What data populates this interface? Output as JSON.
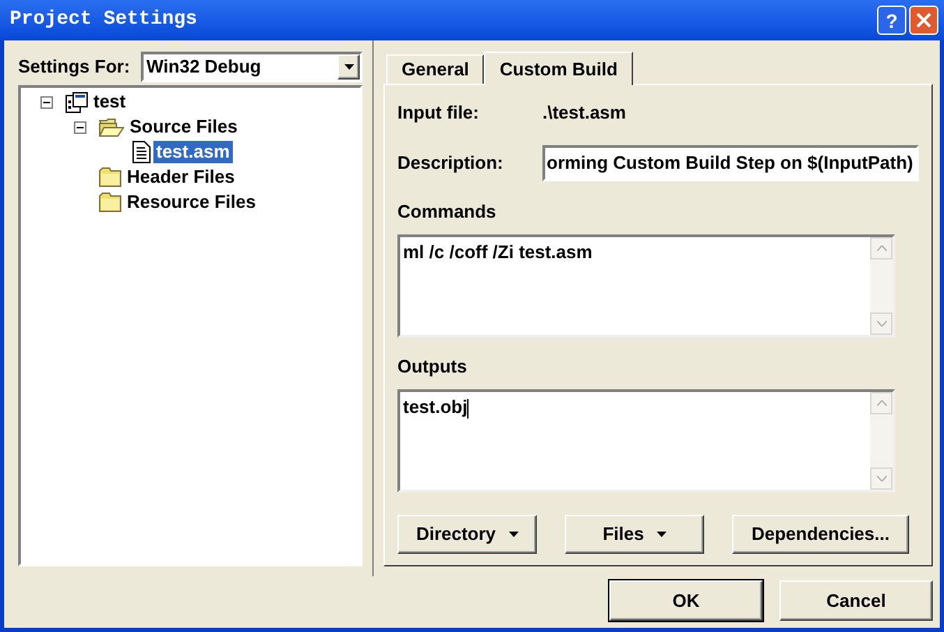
{
  "window": {
    "title": "Project Settings",
    "help_label": "?"
  },
  "settings_for": {
    "label": "Settings For:",
    "value": "Win32 Debug"
  },
  "tree": [
    {
      "label": "test",
      "kind": "project",
      "expanded": true,
      "selected": false,
      "children": [
        {
          "label": "Source Files",
          "kind": "folder",
          "expanded": true,
          "selected": false,
          "children": [
            {
              "label": "test.asm",
              "kind": "file",
              "selected": true
            }
          ]
        },
        {
          "label": "Header Files",
          "kind": "folder",
          "expanded": false,
          "selected": false
        },
        {
          "label": "Resource Files",
          "kind": "folder",
          "expanded": false,
          "selected": false
        }
      ]
    }
  ],
  "tabs": [
    {
      "label": "General",
      "selected": false
    },
    {
      "label": "Custom Build",
      "selected": true
    }
  ],
  "input_file": {
    "label": "Input file:",
    "value": ".\\test.asm"
  },
  "description": {
    "label": "Description:",
    "value": "orming Custom Build Step on $(InputPath)"
  },
  "commands": {
    "label": "Commands",
    "value": "ml /c /coff /Zi test.asm"
  },
  "outputs": {
    "label": "Outputs",
    "value": "test.obj"
  },
  "panel_buttons": [
    {
      "label": "Directory",
      "dropdown": true
    },
    {
      "label": "Files",
      "dropdown": true
    },
    {
      "label": "Dependencies...",
      "dropdown": false
    }
  ],
  "dialog_buttons": [
    {
      "label": "OK",
      "default": true
    },
    {
      "label": "Cancel",
      "default": false
    }
  ]
}
